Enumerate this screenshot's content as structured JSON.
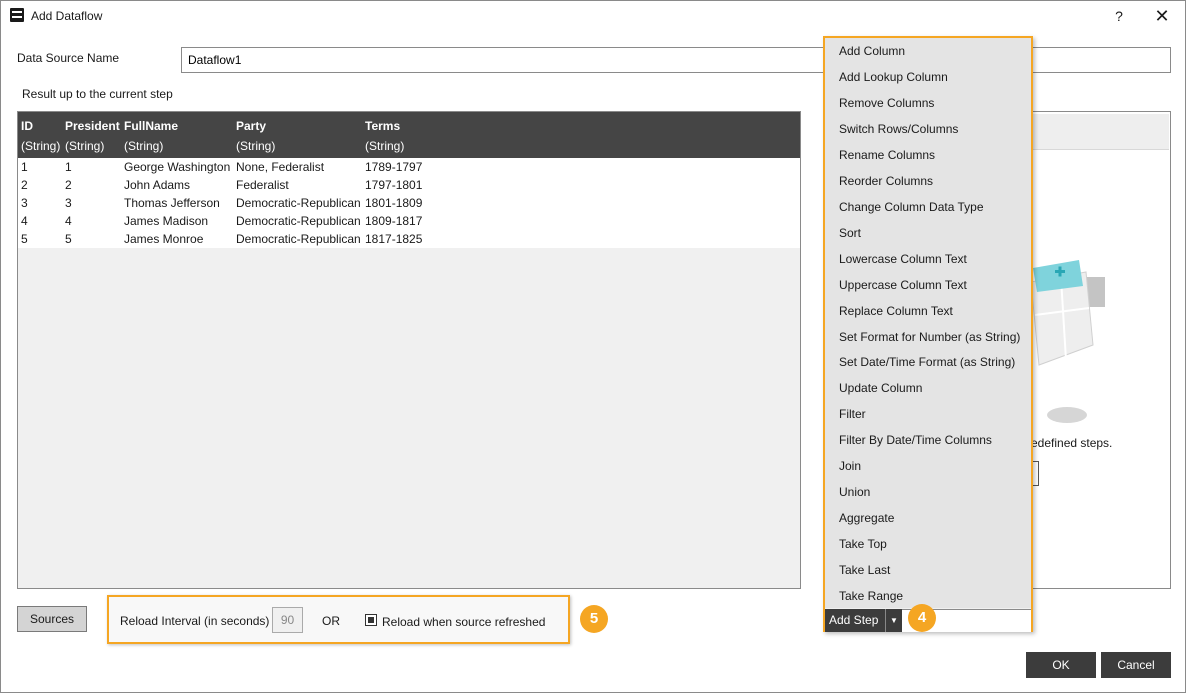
{
  "window": {
    "title": "Add Dataflow",
    "help": "?",
    "close": "✕"
  },
  "data_source": {
    "label": "Data Source Name",
    "value": "Dataflow1"
  },
  "result_label": "Result up to the current step",
  "grid": {
    "columns": [
      {
        "name": "ID",
        "type": "(String)"
      },
      {
        "name": "President",
        "type": "(String)"
      },
      {
        "name": "FullName",
        "type": "(String)"
      },
      {
        "name": "Party",
        "type": "(String)"
      },
      {
        "name": "Terms",
        "type": "(String)"
      }
    ],
    "rows": [
      [
        "1",
        "1",
        "George Washington",
        "None, Federalist",
        "1789-1797"
      ],
      [
        "2",
        "2",
        "John Adams",
        "Federalist",
        "1797-1801"
      ],
      [
        "3",
        "3",
        "Thomas Jefferson",
        "Democratic-Republican",
        "1801-1809"
      ],
      [
        "4",
        "4",
        "James Madison",
        "Democratic-Republican",
        "1809-1817"
      ],
      [
        "5",
        "5",
        "James Monroe",
        "Democratic-Republican",
        "1817-1825"
      ]
    ]
  },
  "right_panel": {
    "partial_text": "edefined steps."
  },
  "add_step_menu": {
    "items": [
      "Add Column",
      "Add Lookup Column",
      "Remove Columns",
      "Switch Rows/Columns",
      "Rename Columns",
      "Reorder Columns",
      "Change Column Data Type",
      "Sort",
      "Lowercase Column Text",
      "Uppercase Column Text",
      "Replace Column Text",
      "Set Format for Number (as String)",
      "Set Date/Time Format (as String)",
      "Update Column",
      "Filter",
      "Filter By Date/Time Columns",
      "Join",
      "Union",
      "Aggregate",
      "Take Top",
      "Take Last",
      "Take Range"
    ],
    "button_label": "Add Step"
  },
  "badges": {
    "step": "4",
    "reload": "5"
  },
  "bottom": {
    "sources_label": "Sources",
    "reload_label": "Reload Interval (in seconds)",
    "reload_value": "90",
    "or_label": "OR",
    "reload_checkbox_label": "Reload when source refreshed",
    "reload_checkbox_checked": true
  },
  "actions": {
    "ok": "OK",
    "cancel": "Cancel"
  },
  "colors": {
    "accent": "#f5a623",
    "header_bg": "#454545",
    "button_dark": "#3c3c3c",
    "illus_teal": "#7fd3dc"
  }
}
